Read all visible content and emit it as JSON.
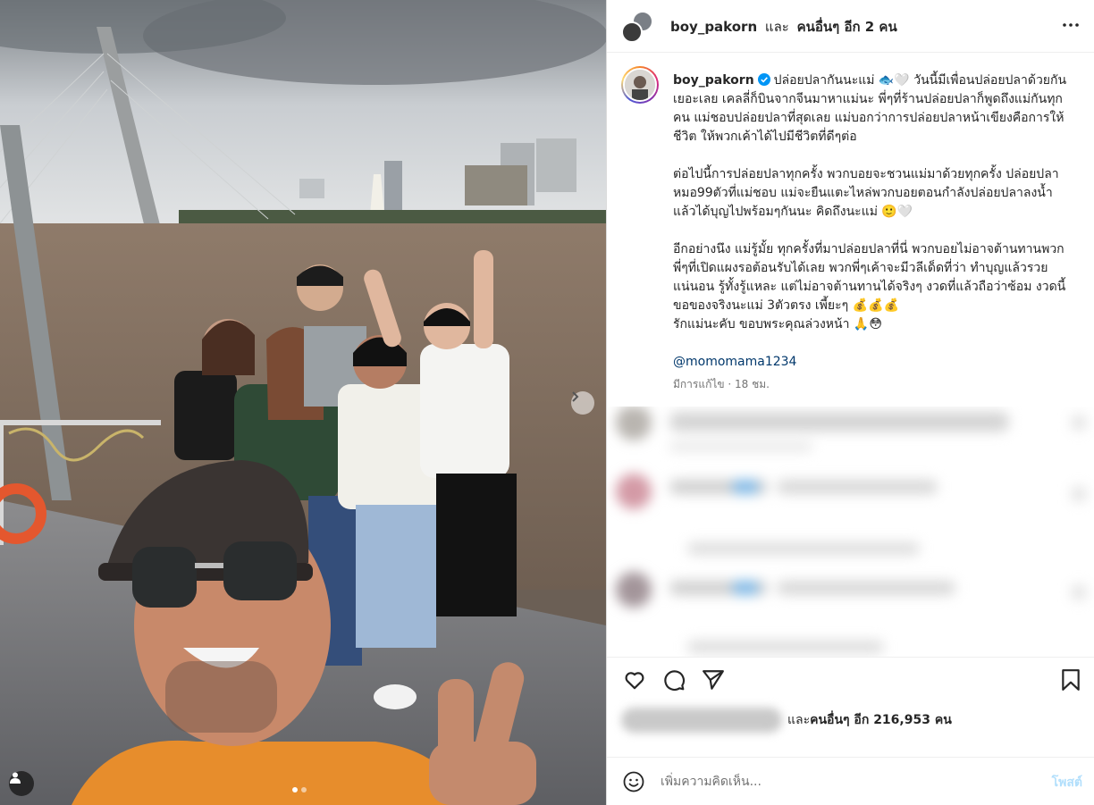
{
  "header": {
    "username": "boy_pakorn",
    "and_text": "และ",
    "others_text": "คนอื่นๆ อีก 2 คน"
  },
  "caption": {
    "username": "boy_pakorn",
    "paragraph1": "ปล่อยปลากันนะแม่ 🐟🤍 วันนี้มีเพื่อนปล่อยปลาด้วยกันเยอะเลย เคลลี่ก็บินจากจีนมาหาแม่นะ พี่ๆที่ร้านปล่อยปลาก็พูดถึงแม่กันทุกคน แม่ชอบปล่อยปลาที่สุดเลย แม่บอกว่าการปล่อยปลาหน้าเขียงคือการให้ชีวิต ให้พวกเค้าได้ไปมีชีวิตที่ดีๆต่อ",
    "paragraph2": "ต่อไปนี้การปล่อยปลาทุกครั้ง พวกบอยจะชวนแม่มาด้วยทุกครั้ง ปล่อยปลาหมอ99ตัวที่แม่ชอบ แม่จะยืนแตะไหล่พวกบอยตอนกำลังปล่อยปลาลงน้ำแล้วได้บุญไปพร้อมๆกันนะ คิดถึงนะแม่ 🙂🤍",
    "paragraph3": "อีกอย่างนึง แม่รู้มั้ย ทุกครั้งที่มาปล่อยปลาที่นี่ พวกบอยไม่อาจต้านทานพวกพี่ๆที่เปิดแผงรอต้อนรับได้เลย พวกพี่ๆเค้าจะมีวลีเด็ดที่ว่า ทำบุญแล้วรวยแน่นอน รู้ทั้งรู้แหละ แต่ไม่อาจต้านทานได้จริงๆ งวดที่แล้วถือว่าซ้อม งวดนี้ขอของจริงนะแม่ 3ตัวตรง เพี้ยะๆ 💰💰💰\nรักแม่นะคับ ขอบพระคุณล่วงหน้า 🙏😳",
    "mention": "@momomama1234",
    "meta": "มีการแก้ไข · 18 ชม."
  },
  "likes": {
    "suffix_and": "และ",
    "suffix_bold": "คนอื่นๆ อีก 216,953 คน"
  },
  "comment_box": {
    "placeholder": "เพิ่มความคิดเห็น...",
    "post_label": "โพสต์"
  },
  "icons": {
    "like": "heart-icon",
    "comment": "comment-icon",
    "share": "send-icon",
    "save": "bookmark-icon",
    "more": "more-icon",
    "emoji": "emoji-icon",
    "user_tag": "user-tag-icon",
    "next": "chevron-right-icon",
    "verified": "verified-badge-icon"
  },
  "colors": {
    "accent_link": "#00376b",
    "verified": "#0095f6",
    "post_disabled": "#b2dffc"
  },
  "carousel": {
    "count": 2,
    "active": 1
  }
}
